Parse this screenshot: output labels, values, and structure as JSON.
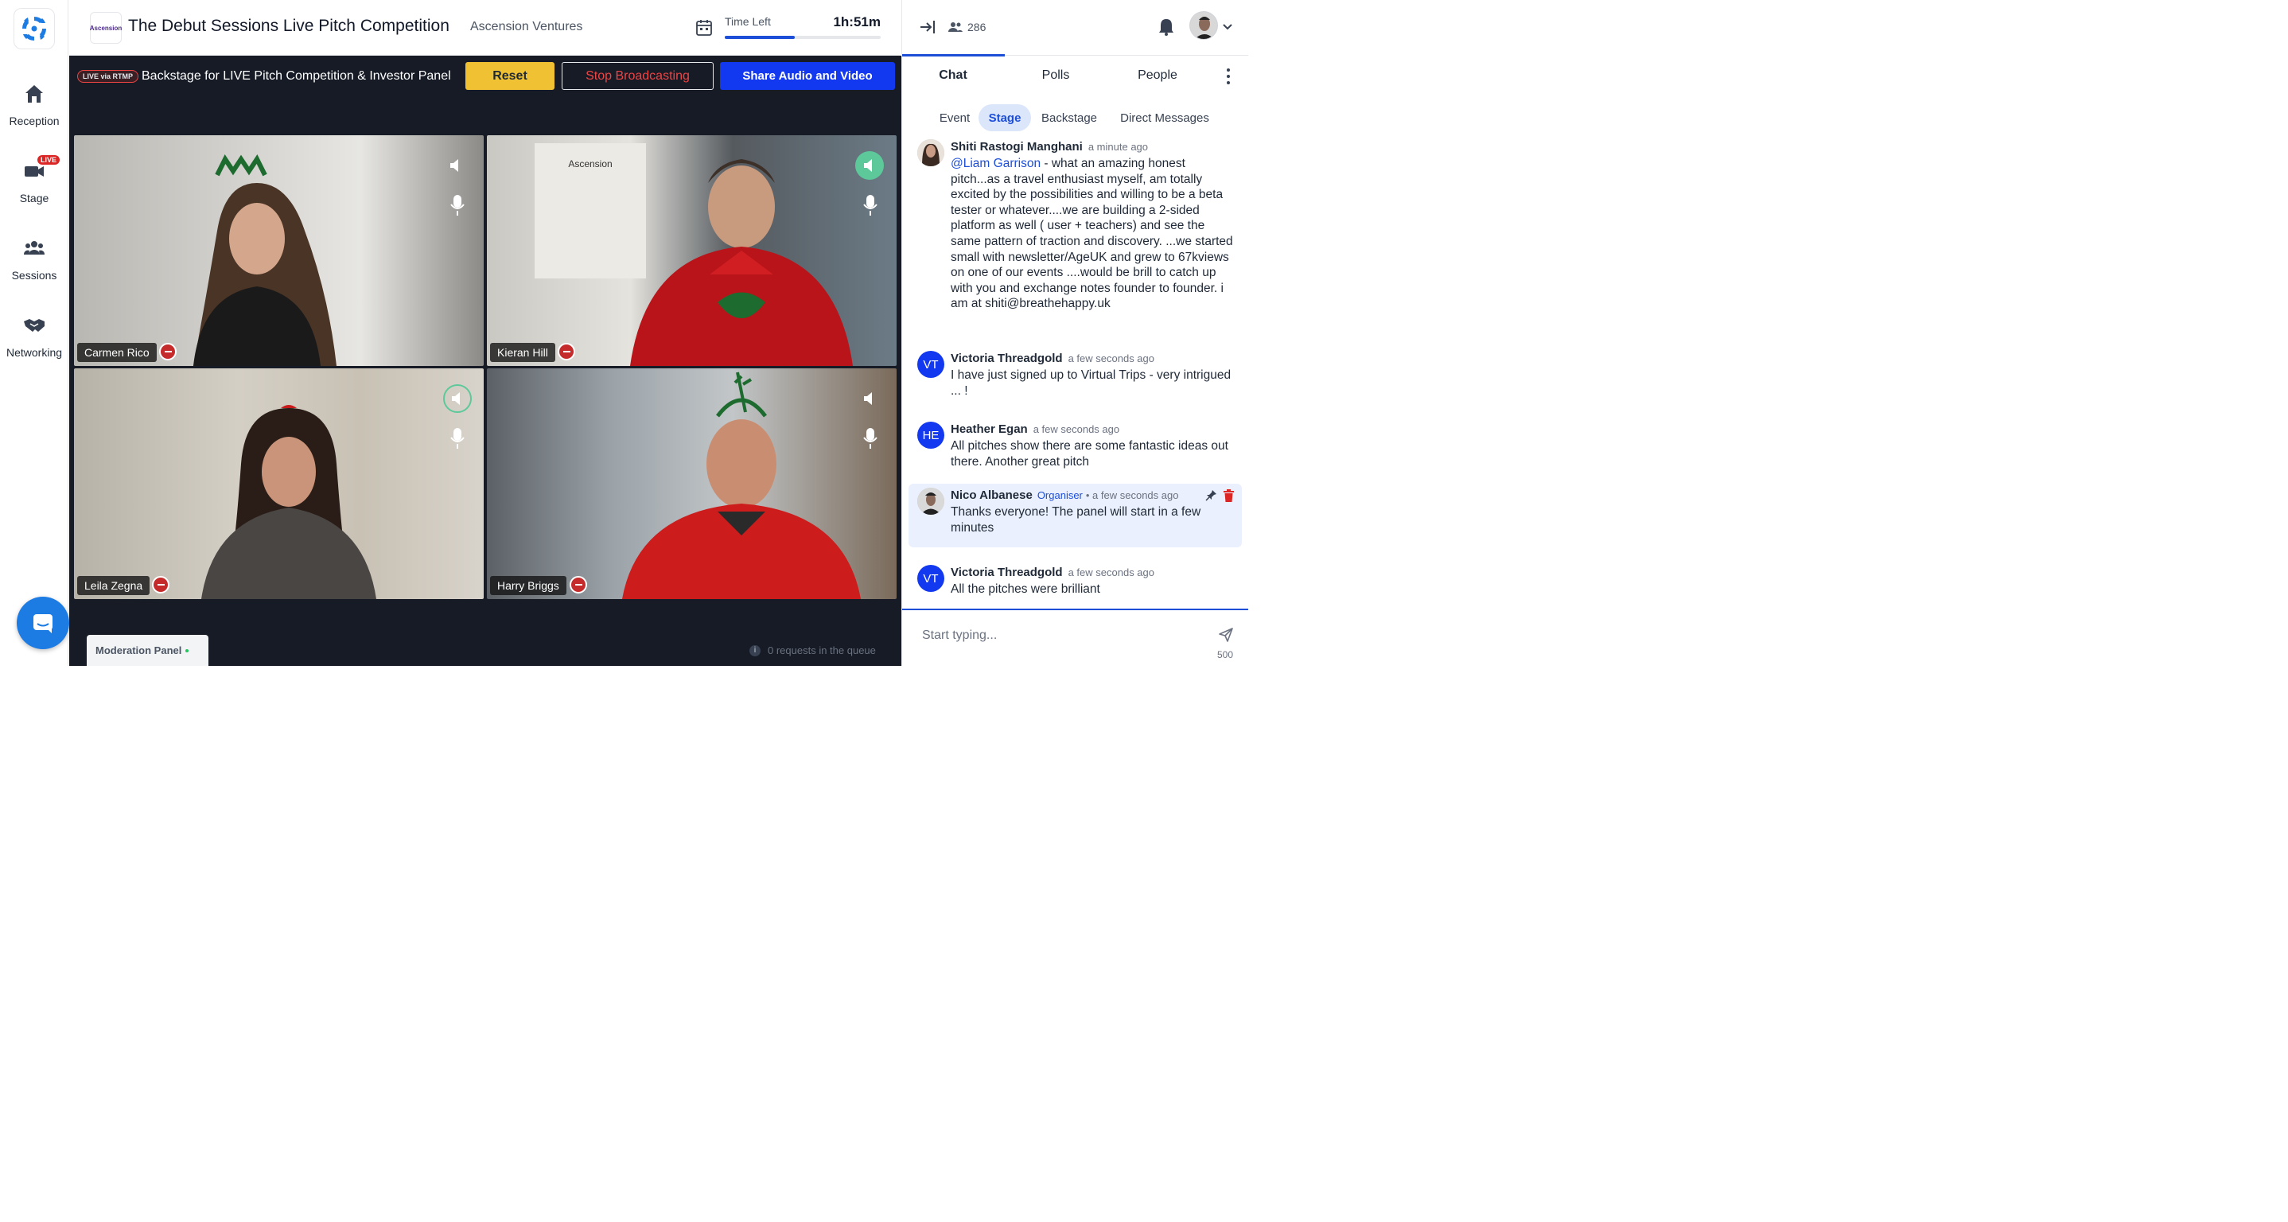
{
  "nav": {
    "items": [
      {
        "label": "Reception",
        "icon": "home-icon"
      },
      {
        "label": "Stage",
        "icon": "camera-icon",
        "badge": "LIVE"
      },
      {
        "label": "Sessions",
        "icon": "group-icon"
      },
      {
        "label": "Networking",
        "icon": "handshake-icon"
      }
    ]
  },
  "header": {
    "org_logo_text": "Ascension",
    "title": "The Debut Sessions Live Pitch Competition",
    "org_name": "Ascension Ventures",
    "time_left_label": "Time Left",
    "time_left_value": "1h:51m",
    "time_progress": 0.45
  },
  "stage": {
    "rtmp_badge": "LIVE via RTMP",
    "backstage_title": "Backstage for LIVE Pitch Competition & Investor Panel",
    "reset_label": "Reset",
    "stop_label": "Stop Broadcasting",
    "share_label": "Share Audio and Video",
    "tiles": [
      {
        "name": "Carmen Rico"
      },
      {
        "name": "Kieran Hill"
      },
      {
        "name": "Leila Zegna"
      },
      {
        "name": "Harry Briggs"
      }
    ],
    "moderation_label": "Moderation Panel",
    "queue_text": "0 requests in the queue"
  },
  "right": {
    "people_count": "286",
    "tabs": {
      "chat": "Chat",
      "polls": "Polls",
      "people": "People"
    },
    "subtabs": {
      "event": "Event",
      "stage": "Stage",
      "backstage": "Backstage",
      "dm": "Direct Messages"
    },
    "messages": [
      {
        "name": "Shiti Rastogi Manghani",
        "time": "a minute ago",
        "mention": "@Liam Garrison",
        "text": " - what an amazing honest pitch...as a travel enthusiast myself, am totally excited by the possibilities and willing to be a beta tester or whatever....we are building a 2-sided platform as well ( user + teachers) and see the same pattern of traction and discovery. ...we started small with newsletter/AgeUK and grew to 67kviews on one of our events ....would be brill to catch up with you and exchange notes founder to founder. i am at shiti@breathehappy.uk"
      },
      {
        "initials": "VT",
        "name": "Victoria Threadgold",
        "time": "a few seconds ago",
        "text": "I have just signed up to Virtual Trips - very intrigued ... !"
      },
      {
        "initials": "HE",
        "name": "Heather Egan",
        "time": "a few seconds ago",
        "text": "All pitches show there are some fantastic ideas out there. Another great pitch"
      },
      {
        "name": "Nico Albanese",
        "role": "Organiser",
        "time": "• a few seconds ago",
        "text": "Thanks everyone! The panel will start in a few minutes"
      },
      {
        "initials": "VT",
        "name": "Victoria Threadgold",
        "time": "a few seconds ago",
        "text": "All the pitches were brilliant"
      }
    ],
    "composer_placeholder": "Start typing...",
    "char_limit": "500"
  }
}
